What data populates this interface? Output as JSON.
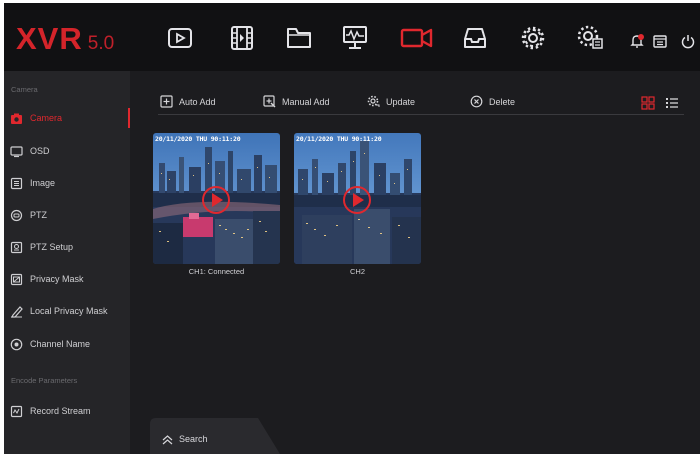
{
  "app": {
    "logo_main": "XVR",
    "logo_version": "5.0"
  },
  "topbar": {
    "icons": [
      "playback-icon",
      "video-film-icon",
      "folder-icon",
      "monitor-waveform-icon",
      "camera-icon",
      "storage-tray-icon",
      "settings-gear-icon",
      "system-settings-icon",
      "alarm-bell-icon",
      "calendar-icon",
      "power-icon"
    ],
    "active_icon": "camera-icon"
  },
  "sidebar": {
    "section_camera": "Camera",
    "items_camera": [
      {
        "label": "Camera",
        "icon": "camera-icon",
        "active": true
      },
      {
        "label": "OSD",
        "icon": "monitor-icon",
        "active": false
      },
      {
        "label": "Image",
        "icon": "image-list-icon",
        "active": false
      },
      {
        "label": "PTZ",
        "icon": "ptz-icon",
        "active": false
      },
      {
        "label": "PTZ Setup",
        "icon": "ptz-setup-icon",
        "active": false
      },
      {
        "label": "Privacy Mask",
        "icon": "privacy-mask-icon",
        "active": false
      },
      {
        "label": "Local Privacy Mask",
        "icon": "local-privacy-mask-icon",
        "active": false
      },
      {
        "label": "Channel Name",
        "icon": "channel-name-icon",
        "active": false
      }
    ],
    "section_encode": "Encode Parameters",
    "items_encode": [
      {
        "label": "Record Stream",
        "icon": "record-stream-icon",
        "active": false
      }
    ]
  },
  "toolbar": {
    "auto_add": "Auto Add",
    "manual_add": "Manual Add",
    "update": "Update",
    "delete": "Delete",
    "view_mode": "grid"
  },
  "cameras": [
    {
      "osd": "20/11/2020 THU 90:11:20",
      "label": "CH1: Connected"
    },
    {
      "osd": "20/11/2020 THU 90:11:20",
      "label": "CH2"
    }
  ],
  "search": {
    "label": "Search"
  },
  "colors": {
    "accent": "#e0282e",
    "background": "#1c1c1f",
    "sidebar": "#252528",
    "topbar": "#111113"
  }
}
